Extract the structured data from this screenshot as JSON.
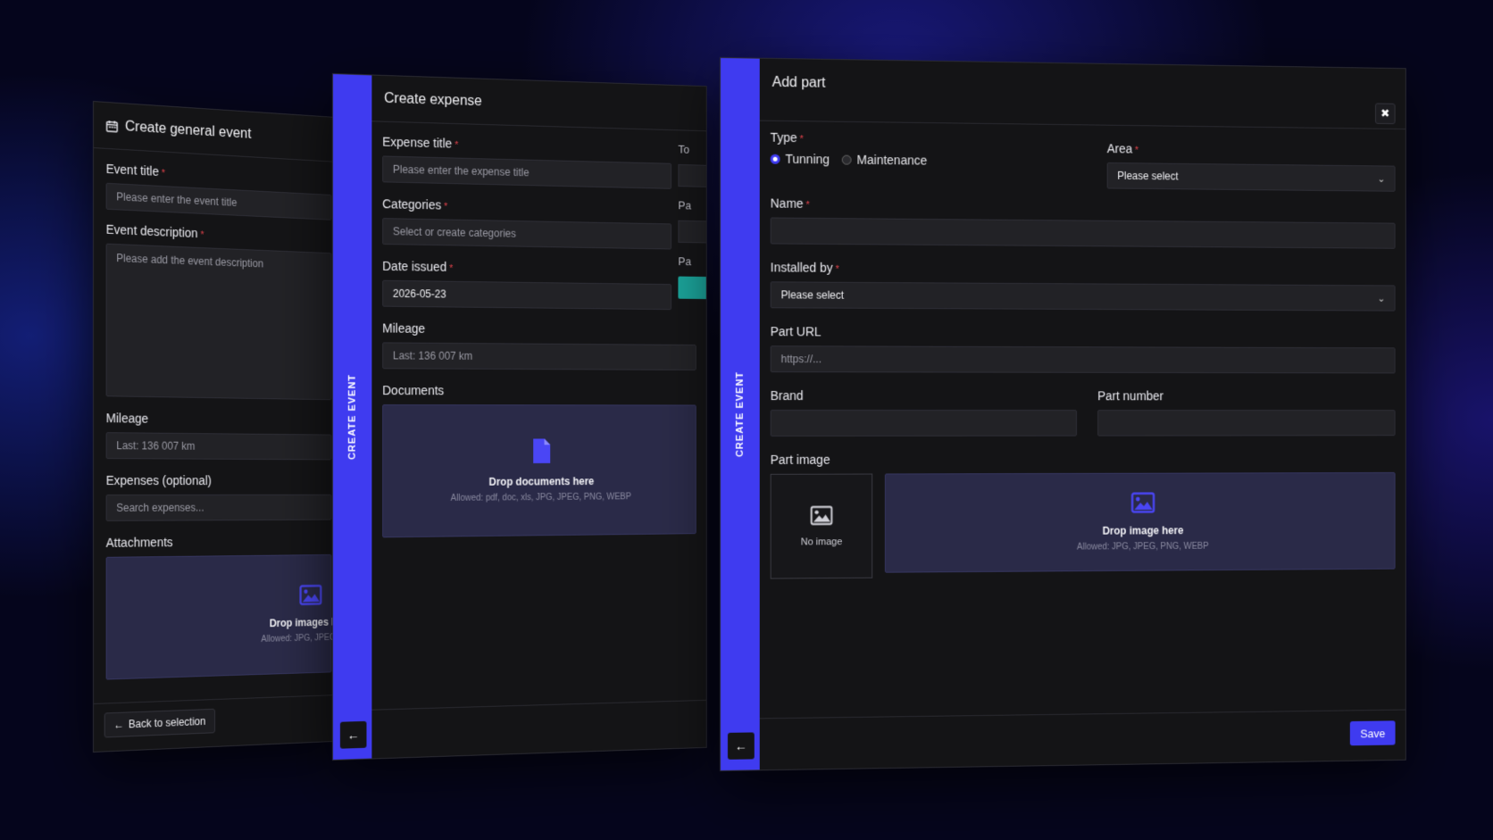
{
  "general_event": {
    "title": "Create general event",
    "event_title_label": "Event title",
    "event_title_placeholder": "Please enter the event title",
    "description_label": "Event description",
    "description_placeholder": "Please add the event description",
    "mileage_label": "Mileage",
    "mileage_placeholder": "Last: 136 007 km",
    "expenses_label": "Expenses (optional)",
    "expenses_placeholder": "Search expenses...",
    "attachments_label": "Attachments",
    "drop_title": "Drop images here",
    "drop_hint": "Allowed: JPG, JPEG, PNG,",
    "back_label": "Back to selection"
  },
  "expense": {
    "title": "Create expense",
    "sidebar_label": "CREATE EVENT",
    "expense_title_label": "Expense title",
    "expense_title_placeholder": "Please enter the expense title",
    "categories_label": "Categories",
    "categories_placeholder": "Select or create categories",
    "date_label": "Date issued",
    "date_value": "2026-05-23",
    "mileage_label": "Mileage",
    "mileage_placeholder": "Last: 136 007 km",
    "documents_label": "Documents",
    "drop_title": "Drop documents here",
    "drop_hint": "Allowed: pdf, doc, xls, JPG, JPEG, PNG, WEBP",
    "side_labels": [
      "To",
      "Pa",
      "Pa"
    ],
    "teal_accent": "#1aa39a"
  },
  "add_part": {
    "title": "Add part",
    "sidebar_label": "CREATE EVENT",
    "type_label": "Type",
    "type_options": [
      "Tunning",
      "Maintenance"
    ],
    "type_selected": "Tunning",
    "area_label": "Area",
    "area_value": "Please select",
    "name_label": "Name",
    "installed_by_label": "Installed by",
    "installed_by_value": "Please select",
    "part_url_label": "Part URL",
    "part_url_placeholder": "https://...",
    "brand_label": "Brand",
    "part_number_label": "Part number",
    "part_image_label": "Part image",
    "no_image_label": "No image",
    "drop_title": "Drop image here",
    "drop_hint": "Allowed: JPG, JPEG, PNG, WEBP",
    "save_label": "Save"
  },
  "colors": {
    "accent": "#3f3bf0",
    "required": "#e0424a",
    "panel_bg": "#141416"
  },
  "icons": [
    "calendar-icon",
    "image-icon",
    "document-icon",
    "arrow-left-icon",
    "close-icon",
    "chevron-down-icon"
  ]
}
